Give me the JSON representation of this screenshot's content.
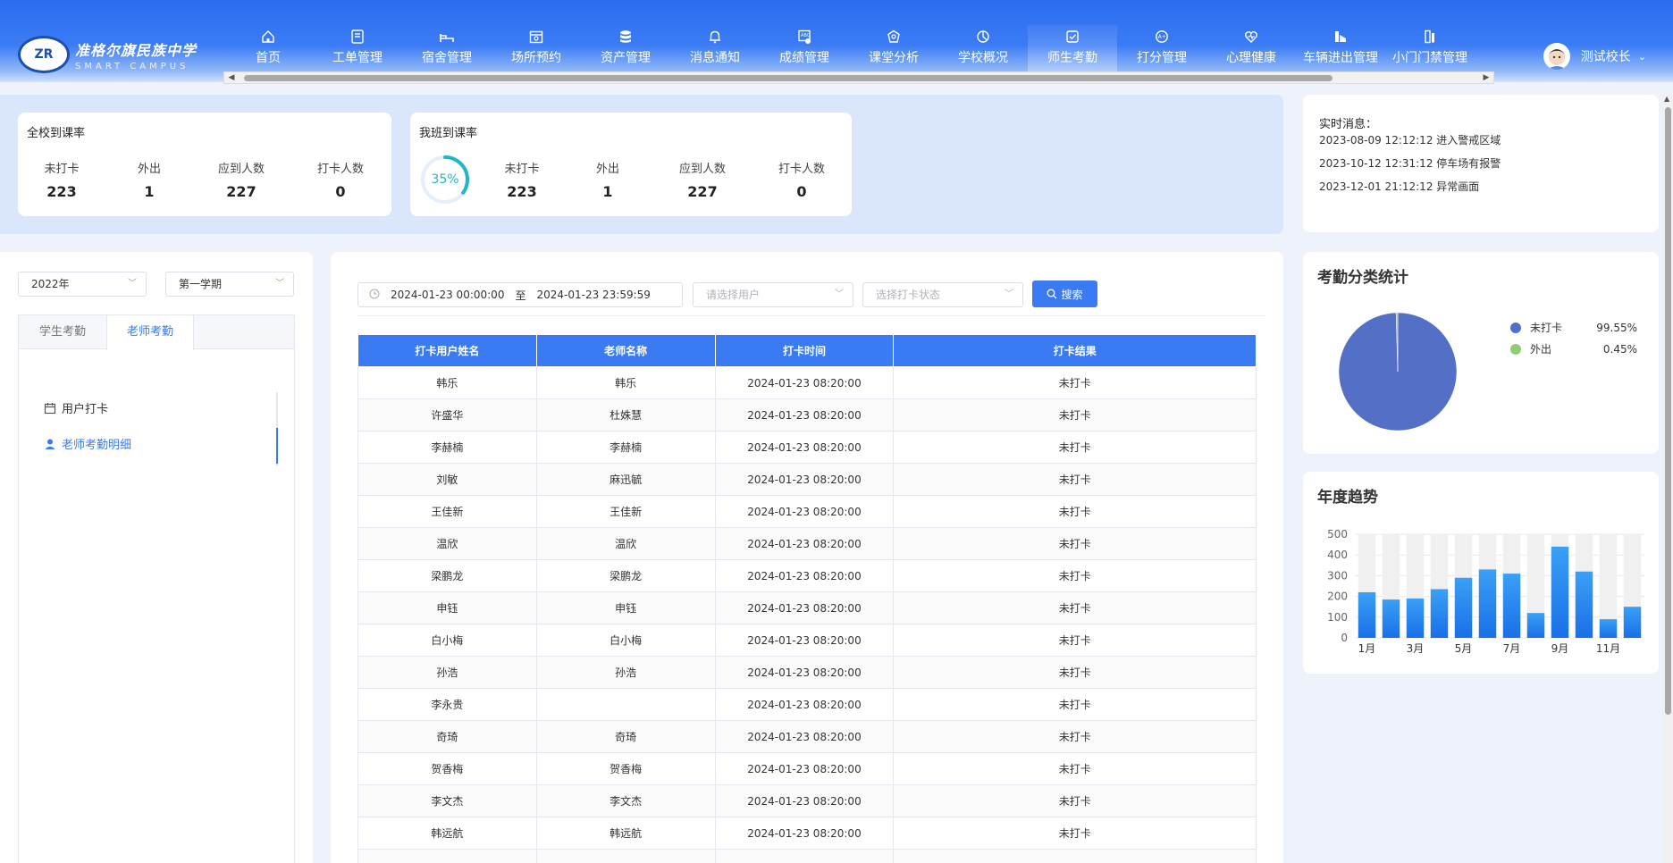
{
  "app": {
    "school_name": "准格尔旗民族中学",
    "school_sub": "SMART CAMPUS",
    "logo_mark": "ZR"
  },
  "nav": [
    {
      "label": "首页",
      "icon": "home-icon",
      "active": false
    },
    {
      "label": "工单管理",
      "icon": "ticket-icon",
      "active": false
    },
    {
      "label": "宿舍管理",
      "icon": "bed-icon",
      "active": false
    },
    {
      "label": "场所预约",
      "icon": "calendar-icon",
      "active": false
    },
    {
      "label": "资产管理",
      "icon": "database-icon",
      "active": false
    },
    {
      "label": "消息通知",
      "icon": "bell-icon",
      "active": false
    },
    {
      "label": "成绩管理",
      "icon": "report-icon",
      "active": false
    },
    {
      "label": "课堂分析",
      "icon": "class-icon",
      "active": false
    },
    {
      "label": "学校概况",
      "icon": "pie-icon",
      "active": false
    },
    {
      "label": "师生考勤",
      "icon": "checkin-icon",
      "active": true
    },
    {
      "label": "打分管理",
      "icon": "score-icon",
      "active": false
    },
    {
      "label": "心理健康",
      "icon": "heart-icon",
      "active": false
    },
    {
      "label": "车辆进出管理",
      "icon": "vehicle-icon",
      "active": false
    },
    {
      "label": "小门门禁管理",
      "icon": "door-icon",
      "active": false
    }
  ],
  "user": {
    "name": "测试校长"
  },
  "school_rate": {
    "title": "全校到课率",
    "items": [
      {
        "label": "未打卡",
        "value": "223"
      },
      {
        "label": "外出",
        "value": "1"
      },
      {
        "label": "应到人数",
        "value": "227"
      },
      {
        "label": "打卡人数",
        "value": "0"
      }
    ]
  },
  "class_rate": {
    "title": "我班到课率",
    "percent_text": "35%",
    "percent": 35,
    "items": [
      {
        "label": "未打卡",
        "value": "223"
      },
      {
        "label": "外出",
        "value": "1"
      },
      {
        "label": "应到人数",
        "value": "227"
      },
      {
        "label": "打卡人数",
        "value": "0"
      }
    ]
  },
  "messages": {
    "title": "实时消息：",
    "items": [
      "2023-08-09 12:12:12 进入警戒区域",
      "2023-10-12 12:31:12 停车场有报警",
      "2023-12-01 21:12:12 异常画面"
    ]
  },
  "filters": {
    "year": "2022年",
    "term": "第一学期"
  },
  "tabs": [
    {
      "label": "学生考勤",
      "active": false
    },
    {
      "label": "老师考勤",
      "active": true
    }
  ],
  "side_menu": [
    {
      "label": "用户打卡",
      "icon": "calendar-small-icon",
      "active": false
    },
    {
      "label": "老师考勤明细",
      "icon": "user-icon",
      "active": true
    }
  ],
  "search": {
    "start": "2024-01-23 00:00:00",
    "separator": "至",
    "end": "2024-01-23 23:59:59",
    "user_placeholder": "请选择用户",
    "status_placeholder": "选择打卡状态",
    "button": "搜索"
  },
  "table": {
    "columns": [
      "打卡用户姓名",
      "老师名称",
      "打卡时间",
      "打卡结果"
    ],
    "rows": [
      [
        "韩乐",
        "韩乐",
        "2024-01-23 08:20:00",
        "未打卡"
      ],
      [
        "许盛华",
        "杜姝慧",
        "2024-01-23 08:20:00",
        "未打卡"
      ],
      [
        "李赫楠",
        "李赫楠",
        "2024-01-23 08:20:00",
        "未打卡"
      ],
      [
        "刘敏",
        "麻迅毓",
        "2024-01-23 08:20:00",
        "未打卡"
      ],
      [
        "王佳新",
        "王佳新",
        "2024-01-23 08:20:00",
        "未打卡"
      ],
      [
        "温欣",
        "温欣",
        "2024-01-23 08:20:00",
        "未打卡"
      ],
      [
        "梁鹏龙",
        "梁鹏龙",
        "2024-01-23 08:20:00",
        "未打卡"
      ],
      [
        "申钰",
        "申钰",
        "2024-01-23 08:20:00",
        "未打卡"
      ],
      [
        "白小梅",
        "白小梅",
        "2024-01-23 08:20:00",
        "未打卡"
      ],
      [
        "孙浩",
        "孙浩",
        "2024-01-23 08:20:00",
        "未打卡"
      ],
      [
        "李永贵",
        "",
        "2024-01-23 08:20:00",
        "未打卡"
      ],
      [
        "奇琦",
        "奇琦",
        "2024-01-23 08:20:00",
        "未打卡"
      ],
      [
        "贺香梅",
        "贺香梅",
        "2024-01-23 08:20:00",
        "未打卡"
      ],
      [
        "李文杰",
        "李文杰",
        "2024-01-23 08:20:00",
        "未打卡"
      ],
      [
        "韩远航",
        "韩远航",
        "2024-01-23 08:20:00",
        "未打卡"
      ],
      [
        "",
        "",
        "",
        ""
      ]
    ]
  },
  "attendance_stats": {
    "title": "考勤分类统计",
    "colors": [
      "#5470c6",
      "#91cc75"
    ],
    "legend": [
      {
        "label": "未打卡",
        "value": 99.55,
        "text": "99.55%"
      },
      {
        "label": "外出",
        "value": 0.45,
        "text": "0.45%"
      }
    ]
  },
  "chart_data": {
    "type": "bar",
    "title": "年度趋势",
    "categories": [
      "1月",
      "2月",
      "3月",
      "4月",
      "5月",
      "6月",
      "7月",
      "8月",
      "9月",
      "10月",
      "11月",
      "12月"
    ],
    "tick_labels": [
      "1月",
      "",
      "3月",
      "",
      "5月",
      "",
      "7月",
      "",
      "9月",
      "",
      "11月",
      ""
    ],
    "values": [
      220,
      185,
      190,
      235,
      290,
      330,
      310,
      120,
      440,
      320,
      90,
      150
    ],
    "background_max": 500,
    "ylim": [
      0,
      500
    ],
    "yticks": [
      0,
      100,
      200,
      300,
      400,
      500
    ],
    "grid": true
  }
}
